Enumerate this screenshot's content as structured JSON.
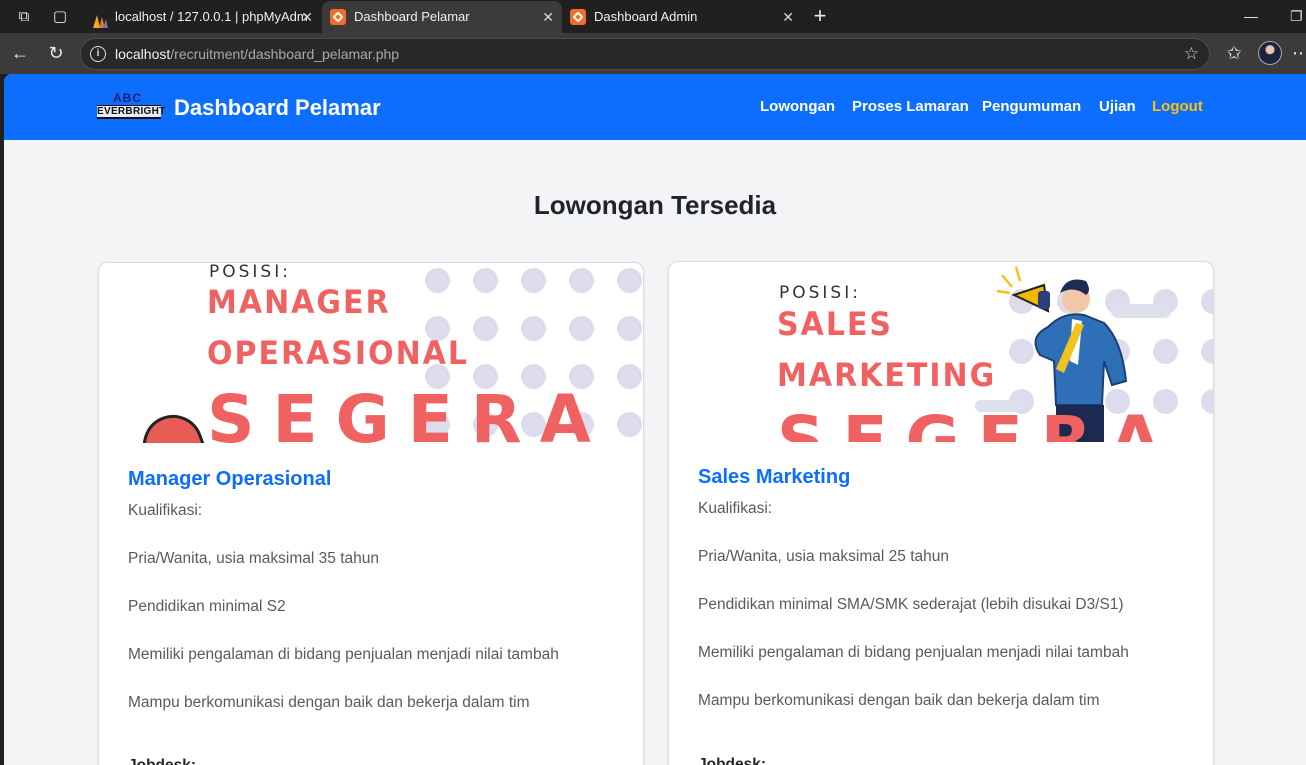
{
  "browser": {
    "tabs": [
      {
        "title": "localhost / 127.0.0.1 | phpMyAdm",
        "icon": "phpmyadmin-icon",
        "active": false
      },
      {
        "title": "Dashboard Pelamar",
        "icon": "xampp-icon",
        "active": true
      },
      {
        "title": "Dashboard Admin",
        "icon": "xampp-icon",
        "active": false
      }
    ],
    "url_host": "localhost",
    "url_path": "/recruitment/dashboard_pelamar.php"
  },
  "header": {
    "logo_top": "ABC",
    "logo_bottom": "EVERBRIGHT",
    "title": "Dashboard Pelamar",
    "menu": [
      "Lowongan",
      "Proses Lamaran",
      "Pengumuman",
      "Ujian",
      "Logout"
    ]
  },
  "main": {
    "heading": "Lowongan Tersedia",
    "jobs": [
      {
        "banner_label": "POSISI:",
        "banner_title_1": "MANAGER",
        "banner_title_2": "OPERASIONAL",
        "banner_segera": "SEGERA",
        "title": "Manager Operasional",
        "qual_label": "Kualifikasi:",
        "quals": [
          "Pria/Wanita, usia maksimal 35 tahun",
          "Pendidikan minimal S2",
          "Memiliki pengalaman di bidang penjualan menjadi nilai tambah",
          "Mampu berkomunikasi dengan baik dan bekerja dalam tim"
        ],
        "next_label": "Jobdesk:"
      },
      {
        "banner_label": "POSISI:",
        "banner_title_1": "SALES",
        "banner_title_2": "MARKETING",
        "banner_segera": "SEGERA",
        "title": "Sales Marketing",
        "qual_label": "Kualifikasi:",
        "quals": [
          "Pria/Wanita, usia maksimal 25 tahun",
          "Pendidikan minimal SMA/SMK sederajat (lebih disukai D3/S1)",
          "Memiliki pengalaman di bidang penjualan menjadi nilai tambah",
          "Mampu berkomunikasi dengan baik dan bekerja dalam tim"
        ],
        "next_label": "Jobdesk:"
      }
    ]
  },
  "colors": {
    "primary": "#0d6efd",
    "logout": "#ffc107",
    "banner_red": "#f06262"
  }
}
